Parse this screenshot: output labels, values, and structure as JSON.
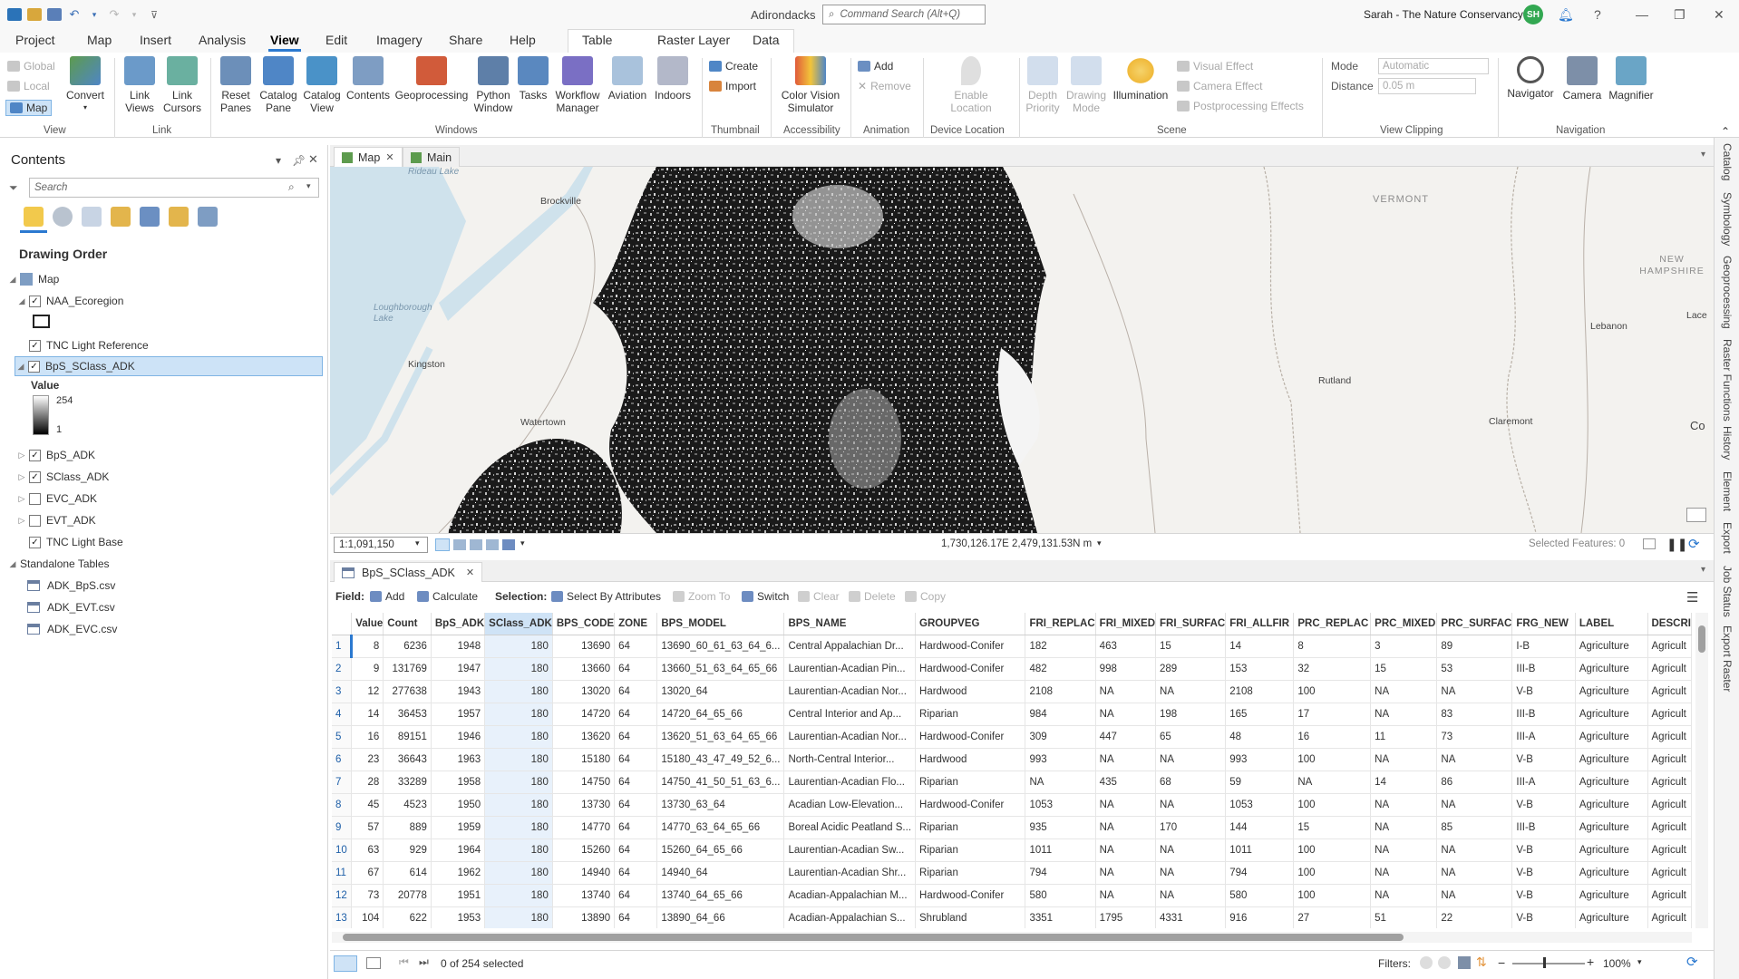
{
  "titlebar": {
    "project_name": "Adirondacks",
    "command_search_placeholder": "Command Search (Alt+Q)",
    "user": "Sarah - The Nature Conservancy",
    "avatar_initials": "SH"
  },
  "menu": {
    "tabs": [
      "Project",
      "Map",
      "Insert",
      "Analysis",
      "View",
      "Edit",
      "Imagery",
      "Share",
      "Help"
    ],
    "active": "View",
    "context_tabs": [
      "Table",
      "Raster Layer",
      "Data"
    ]
  },
  "ribbon": {
    "view_group": {
      "global": "Global",
      "local": "Local",
      "map": "Map",
      "convert": "Convert",
      "label": "View"
    },
    "link_group": {
      "link_views": "Link Views",
      "link_cursors": "Link Cursors",
      "label": "Link"
    },
    "windows_group": {
      "reset_panes": "Reset Panes",
      "catalog_pane": "Catalog Pane",
      "catalog_view": "Catalog View",
      "contents": "Contents",
      "geoprocessing": "Geoprocessing",
      "python_window": "Python Window",
      "tasks": "Tasks",
      "workflow_manager": "Workflow Manager",
      "aviation": "Aviation",
      "indoors": "Indoors",
      "label": "Windows"
    },
    "thumbnail_group": {
      "create": "Create",
      "import": "Import",
      "label": "Thumbnail"
    },
    "accessibility_group": {
      "color_vision": "Color Vision Simulator",
      "label": "Accessibility"
    },
    "animation_group": {
      "add": "Add",
      "remove": "Remove",
      "label": "Animation"
    },
    "device_location_group": {
      "enable_location": "Enable Location",
      "label": "Device Location"
    },
    "scene_group": {
      "depth_priority": "Depth Priority",
      "drawing_mode": "Drawing Mode",
      "illumination": "Illumination",
      "visual_effect": "Visual Effect",
      "camera_effect": "Camera Effect",
      "postprocessing": "Postprocessing Effects",
      "label": "Scene"
    },
    "view_clipping_group": {
      "mode_label": "Mode",
      "mode_value": "Automatic",
      "distance_label": "Distance",
      "distance_value": "0.05  m",
      "label": "View Clipping"
    },
    "navigation_group": {
      "navigator": "Navigator",
      "camera": "Camera",
      "magnifier": "Magnifier",
      "label": "Navigation"
    }
  },
  "contents": {
    "title": "Contents",
    "search_placeholder": "Search",
    "drawing_order": "Drawing Order",
    "map": "Map",
    "layers": [
      {
        "name": "NAA_Ecoregion",
        "checked": true,
        "expanded": true
      },
      {
        "name": "TNC Light Reference",
        "checked": true
      },
      {
        "name": "BpS_SClass_ADK",
        "checked": true,
        "expanded": true,
        "selected": true
      },
      {
        "name": "BpS_ADK",
        "checked": true
      },
      {
        "name": "SClass_ADK",
        "checked": true
      },
      {
        "name": "EVC_ADK",
        "checked": false
      },
      {
        "name": "EVT_ADK",
        "checked": false
      },
      {
        "name": "TNC Light Base",
        "checked": true
      }
    ],
    "legend": {
      "title": "Value",
      "high": "254",
      "low": "1"
    },
    "standalone_title": "Standalone Tables",
    "standalone_tables": [
      "ADK_BpS.csv",
      "ADK_EVT.csv",
      "ADK_EVC.csv"
    ]
  },
  "map_view": {
    "tabs": [
      "Map",
      "Main"
    ],
    "place_labels": [
      "Rideau Lake",
      "Brockville",
      "Loughborough Lake",
      "Kingston",
      "Watertown",
      "VERMONT",
      "NEW HAMPSHIRE",
      "Lebanon",
      "Rutland",
      "Claremont",
      "Lace",
      "Co"
    ],
    "scale": "1:1,091,150",
    "coordinates": "1,730,126.17E 2,479,131.53N m",
    "selected_features": "Selected Features: 0"
  },
  "table_view": {
    "tab": "BpS_SClass_ADK",
    "toolbar": {
      "field": "Field:",
      "add": "Add",
      "calculate": "Calculate",
      "selection": "Selection:",
      "select_by_attributes": "Select By Attributes",
      "zoom_to": "Zoom To",
      "switch": "Switch",
      "clear": "Clear",
      "delete": "Delete",
      "copy": "Copy"
    },
    "columns": [
      "Value",
      "Count",
      "BpS_ADK",
      "SClass_ADK",
      "BPS_CODE",
      "ZONE",
      "BPS_MODEL",
      "BPS_NAME",
      "GROUPVEG",
      "FRI_REPLAC",
      "FRI_MIXED",
      "FRI_SURFAC",
      "FRI_ALLFIR",
      "PRC_REPLAC",
      "PRC_MIXED",
      "PRC_SURFAC",
      "FRG_NEW",
      "LABEL",
      "DESCRI"
    ],
    "rows": [
      [
        "1",
        "8",
        "6236",
        "1948",
        "180",
        "13690",
        "64",
        "13690_60_61_63_64_6...",
        "Central Appalachian Dr...",
        "Hardwood-Conifer",
        "182",
        "463",
        "15",
        "14",
        "8",
        "3",
        "89",
        "I-B",
        "Agriculture",
        "Agricult"
      ],
      [
        "2",
        "9",
        "131769",
        "1947",
        "180",
        "13660",
        "64",
        "13660_51_63_64_65_66",
        "Laurentian-Acadian Pin...",
        "Hardwood-Conifer",
        "482",
        "998",
        "289",
        "153",
        "32",
        "15",
        "53",
        "III-B",
        "Agriculture",
        "Agricult"
      ],
      [
        "3",
        "12",
        "277638",
        "1943",
        "180",
        "13020",
        "64",
        "13020_64",
        "Laurentian-Acadian Nor...",
        "Hardwood",
        "2108",
        "NA",
        "NA",
        "2108",
        "100",
        "NA",
        "NA",
        "V-B",
        "Agriculture",
        "Agricult"
      ],
      [
        "4",
        "14",
        "36453",
        "1957",
        "180",
        "14720",
        "64",
        "14720_64_65_66",
        "Central Interior and Ap...",
        "Riparian",
        "984",
        "NA",
        "198",
        "165",
        "17",
        "NA",
        "83",
        "III-B",
        "Agriculture",
        "Agricult"
      ],
      [
        "5",
        "16",
        "89151",
        "1946",
        "180",
        "13620",
        "64",
        "13620_51_63_64_65_66",
        "Laurentian-Acadian Nor...",
        "Hardwood-Conifer",
        "309",
        "447",
        "65",
        "48",
        "16",
        "11",
        "73",
        "III-A",
        "Agriculture",
        "Agricult"
      ],
      [
        "6",
        "23",
        "36643",
        "1963",
        "180",
        "15180",
        "64",
        "15180_43_47_49_52_6...",
        "North-Central Interior...",
        "Hardwood",
        "993",
        "NA",
        "NA",
        "993",
        "100",
        "NA",
        "NA",
        "V-B",
        "Agriculture",
        "Agricult"
      ],
      [
        "7",
        "28",
        "33289",
        "1958",
        "180",
        "14750",
        "64",
        "14750_41_50_51_63_6...",
        "Laurentian-Acadian Flo...",
        "Riparian",
        "NA",
        "435",
        "68",
        "59",
        "NA",
        "14",
        "86",
        "III-A",
        "Agriculture",
        "Agricult"
      ],
      [
        "8",
        "45",
        "4523",
        "1950",
        "180",
        "13730",
        "64",
        "13730_63_64",
        "Acadian Low-Elevation...",
        "Hardwood-Conifer",
        "1053",
        "NA",
        "NA",
        "1053",
        "100",
        "NA",
        "NA",
        "V-B",
        "Agriculture",
        "Agricult"
      ],
      [
        "9",
        "57",
        "889",
        "1959",
        "180",
        "14770",
        "64",
        "14770_63_64_65_66",
        "Boreal Acidic Peatland S...",
        "Riparian",
        "935",
        "NA",
        "170",
        "144",
        "15",
        "NA",
        "85",
        "III-B",
        "Agriculture",
        "Agricult"
      ],
      [
        "10",
        "63",
        "929",
        "1964",
        "180",
        "15260",
        "64",
        "15260_64_65_66",
        "Laurentian-Acadian Sw...",
        "Riparian",
        "1011",
        "NA",
        "NA",
        "1011",
        "100",
        "NA",
        "NA",
        "V-B",
        "Agriculture",
        "Agricult"
      ],
      [
        "11",
        "67",
        "614",
        "1962",
        "180",
        "14940",
        "64",
        "14940_64",
        "Laurentian-Acadian Shr...",
        "Riparian",
        "794",
        "NA",
        "NA",
        "794",
        "100",
        "NA",
        "NA",
        "V-B",
        "Agriculture",
        "Agricult"
      ],
      [
        "12",
        "73",
        "20778",
        "1951",
        "180",
        "13740",
        "64",
        "13740_64_65_66",
        "Acadian-Appalachian M...",
        "Hardwood-Conifer",
        "580",
        "NA",
        "NA",
        "580",
        "100",
        "NA",
        "NA",
        "V-B",
        "Agriculture",
        "Agricult"
      ],
      [
        "13",
        "104",
        "622",
        "1953",
        "180",
        "13890",
        "64",
        "13890_64_66",
        "Acadian-Appalachian S...",
        "Shrubland",
        "3351",
        "1795",
        "4331",
        "916",
        "27",
        "51",
        "22",
        "V-B",
        "Agriculture",
        "Agricult"
      ]
    ],
    "status": "0 of 254 selected",
    "filters": "Filters:",
    "zoom": "100%"
  },
  "right_panes": [
    "Catalog",
    "Symbology",
    "Geoprocessing",
    "Raster Functions",
    "History",
    "Element",
    "Export",
    "Job Status",
    "Export Raster"
  ],
  "colors": {
    "accent": "#2b79d0",
    "selection": "#cde3f7",
    "avatar": "#33a852"
  }
}
